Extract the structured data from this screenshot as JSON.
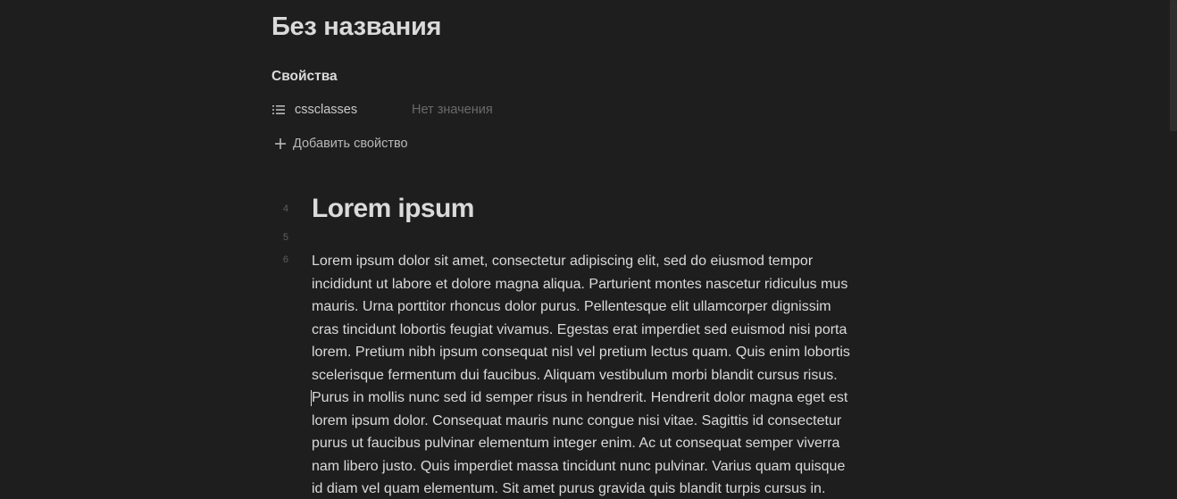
{
  "note": {
    "title": "Без названия"
  },
  "properties": {
    "heading": "Свойства",
    "items": [
      {
        "icon": "list-icon",
        "key": "cssclasses",
        "value": "Нет значения"
      }
    ],
    "add_label": "Добавить свойство"
  },
  "editor": {
    "line_numbers": [
      "4",
      "5",
      "6"
    ],
    "heading": "Lorem ipsum",
    "paragraph_lines": [
      "Lorem ipsum dolor sit amet, consectetur adipiscing elit, sed do eiusmod tempor",
      "incididunt ut labore et dolore magna aliqua. Parturient montes nascetur ridiculus mus",
      "mauris. Urna porttitor rhoncus dolor purus. Pellentesque elit ullamcorper dignissim",
      "cras tincidunt lobortis feugiat vivamus. Egestas erat imperdiet sed euismod nisi porta",
      "lorem. Pretium nibh ipsum consequat nisl vel pretium lectus quam. Quis enim lobortis",
      "scelerisque fermentum dui faucibus. Aliquam vestibulum morbi blandit cursus risus.",
      "Purus in mollis nunc sed id semper risus in hendrerit. Hendrerit dolor magna eget est",
      "lorem ipsum dolor. Consequat mauris nunc congue nisi vitae. Sagittis id consectetur",
      "purus ut faucibus pulvinar elementum integer enim. Ac ut consequat semper viverra",
      "nam libero justo. Quis imperdiet massa tincidunt nunc pulvinar. Varius quam quisque",
      "id diam vel quam elementum. Sit amet purus gravida quis blandit turpis cursus in."
    ]
  },
  "colors": {
    "background": "#1e1e1e",
    "text": "#dadada",
    "muted": "#6a6a6a"
  }
}
